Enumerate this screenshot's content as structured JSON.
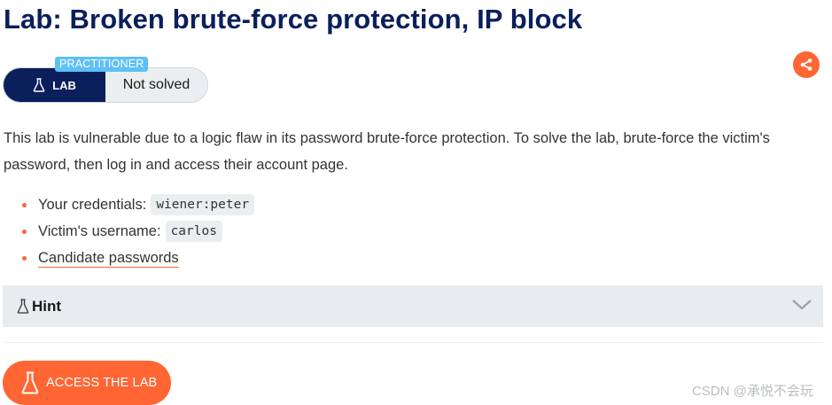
{
  "header": {
    "title": "Lab: Broken brute-force protection, IP block"
  },
  "status": {
    "level_badge": "PRACTITIONER",
    "lab_label": "LAB",
    "solved_label": "Not solved"
  },
  "description": {
    "intro": "This lab is vulnerable due to a logic flaw in its password brute-force protection. To solve the lab, brute-force the victim's password, then log in and access their account page."
  },
  "credentials": {
    "your_label": "Your credentials:",
    "your_value": "wiener:peter",
    "victim_label": "Victim's username:",
    "victim_value": "carlos",
    "candidate_link": "Candidate passwords"
  },
  "hint": {
    "label": "Hint"
  },
  "access": {
    "label": "ACCESS THE LAB"
  },
  "watermark": "CSDN @承悦不会玩",
  "colors": {
    "accent": "#ff6633",
    "navy": "#0a1f5c",
    "badge": "#5ec0f5",
    "panel": "#e8ecef"
  },
  "icons": [
    "share-icon",
    "flask-icon",
    "chevron-down-icon"
  ]
}
